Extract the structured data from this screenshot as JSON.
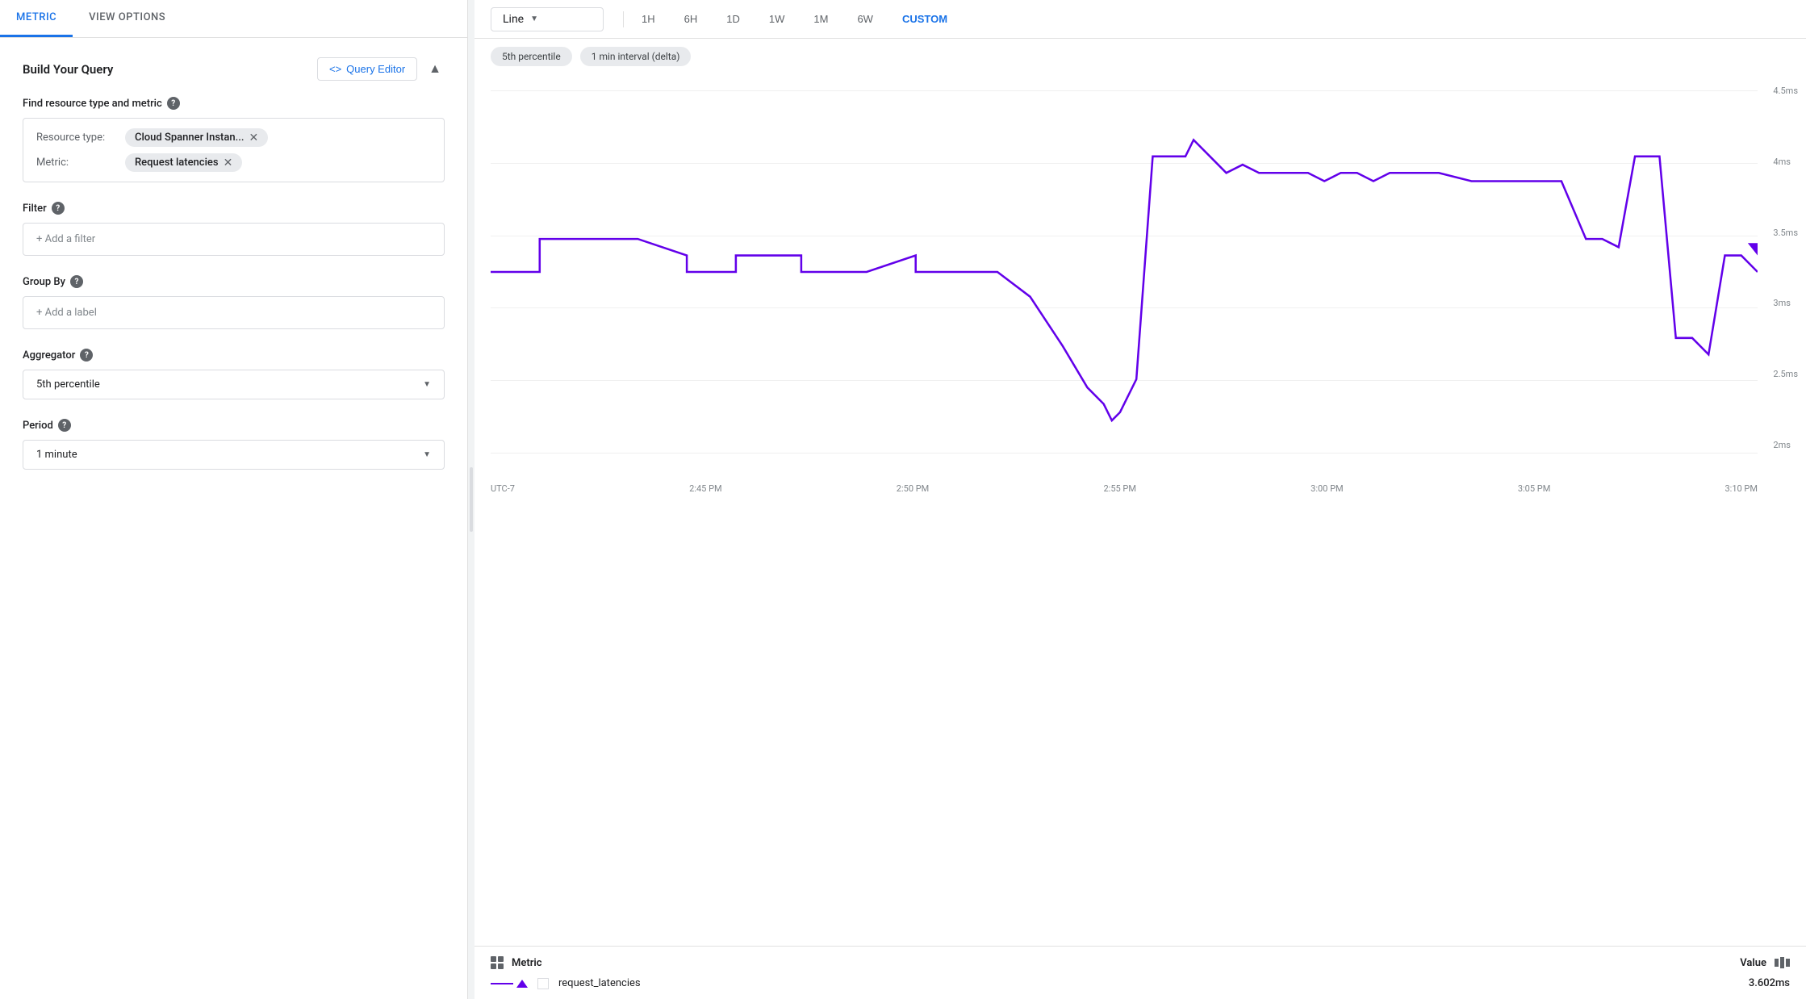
{
  "tabs": {
    "metric": "METRIC",
    "viewOptions": "VIEW OPTIONS"
  },
  "leftPanel": {
    "buildQuery": "Build Your Query",
    "queryEditorBtn": "Query Editor",
    "collapseIcon": "▲",
    "findResourceLabel": "Find resource type and metric",
    "resourceTypeLabel": "Resource type:",
    "resourceTypeValue": "Cloud Spanner Instan...",
    "metricLabel": "Metric:",
    "metricValue": "Request latencies",
    "filterLabel": "Filter",
    "filterPlaceholder": "+ Add a filter",
    "groupByLabel": "Group By",
    "groupByPlaceholder": "+ Add a label",
    "aggregatorLabel": "Aggregator",
    "aggregatorValue": "5th percentile",
    "periodLabel": "Period",
    "periodValue": "1 minute"
  },
  "rightPanel": {
    "chartType": "Line",
    "timeRanges": [
      "1H",
      "6H",
      "1D",
      "1W",
      "1M",
      "6W",
      "CUSTOM"
    ],
    "activeTimeRange": "CUSTOM",
    "filterChips": [
      "5th percentile",
      "1 min interval (delta)"
    ],
    "yAxisLabels": [
      "4.5ms",
      "4ms",
      "3.5ms",
      "3ms",
      "2.5ms",
      "2ms"
    ],
    "xAxisLabels": [
      "UTC-7",
      "2:45 PM",
      "2:50 PM",
      "2:55 PM",
      "3:00 PM",
      "3:05 PM",
      "3:10 PM"
    ],
    "legend": {
      "metricLabel": "Metric",
      "valueLabel": "Value",
      "rows": [
        {
          "name": "request_latencies",
          "value": "3.602ms"
        }
      ]
    }
  }
}
